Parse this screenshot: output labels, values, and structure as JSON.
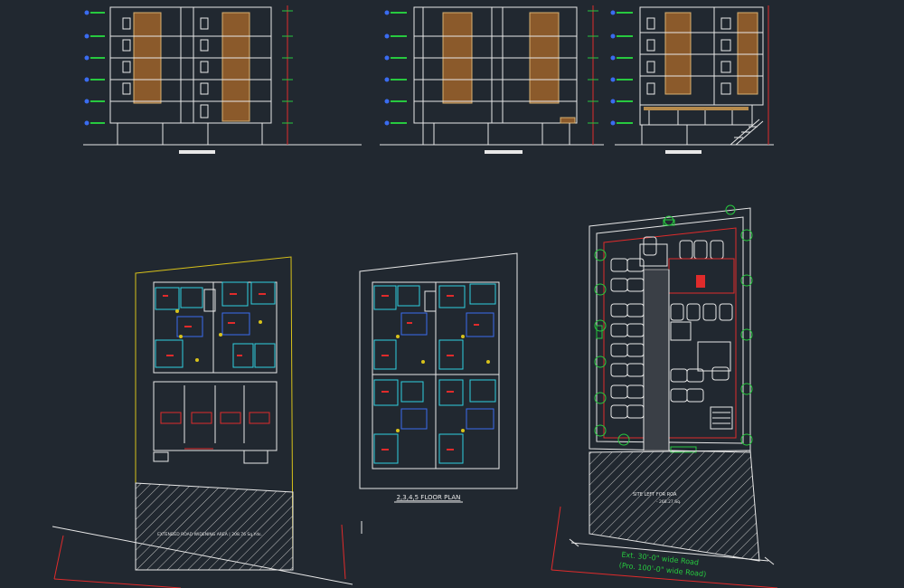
{
  "drawing": {
    "background": "#212830",
    "line_color": "#e8e8e8",
    "accent_colors": {
      "red": "#e02b2b",
      "green": "#27c93f",
      "blue": "#3a6cf0",
      "cyan": "#2fd0e0",
      "yellow": "#d8c21a",
      "brown": "#8b5a2b",
      "tan": "#b58a4c"
    }
  },
  "elevations": [
    {
      "id": "elevation-1"
    },
    {
      "id": "elevation-2"
    },
    {
      "id": "elevation-3"
    }
  ],
  "plans": {
    "ground_floor": {
      "id": "ground-floor-plan",
      "road_text": "EXTENDED ROAD WIDENING AREA | 208.76 Sq.Yds."
    },
    "typical_floor": {
      "id": "typical-floor-plan",
      "title": "2,3,4,5 FLOOR PLAN"
    },
    "site_plan": {
      "id": "site-plan",
      "site_left_label": "SITE LEFT FOR ROA",
      "site_left_area": "- 268.27 Sq.",
      "road_line1": "Ext. 30'-0\" wide Road",
      "road_line2": "(Pro. 100'-0\" wide Road)"
    }
  }
}
